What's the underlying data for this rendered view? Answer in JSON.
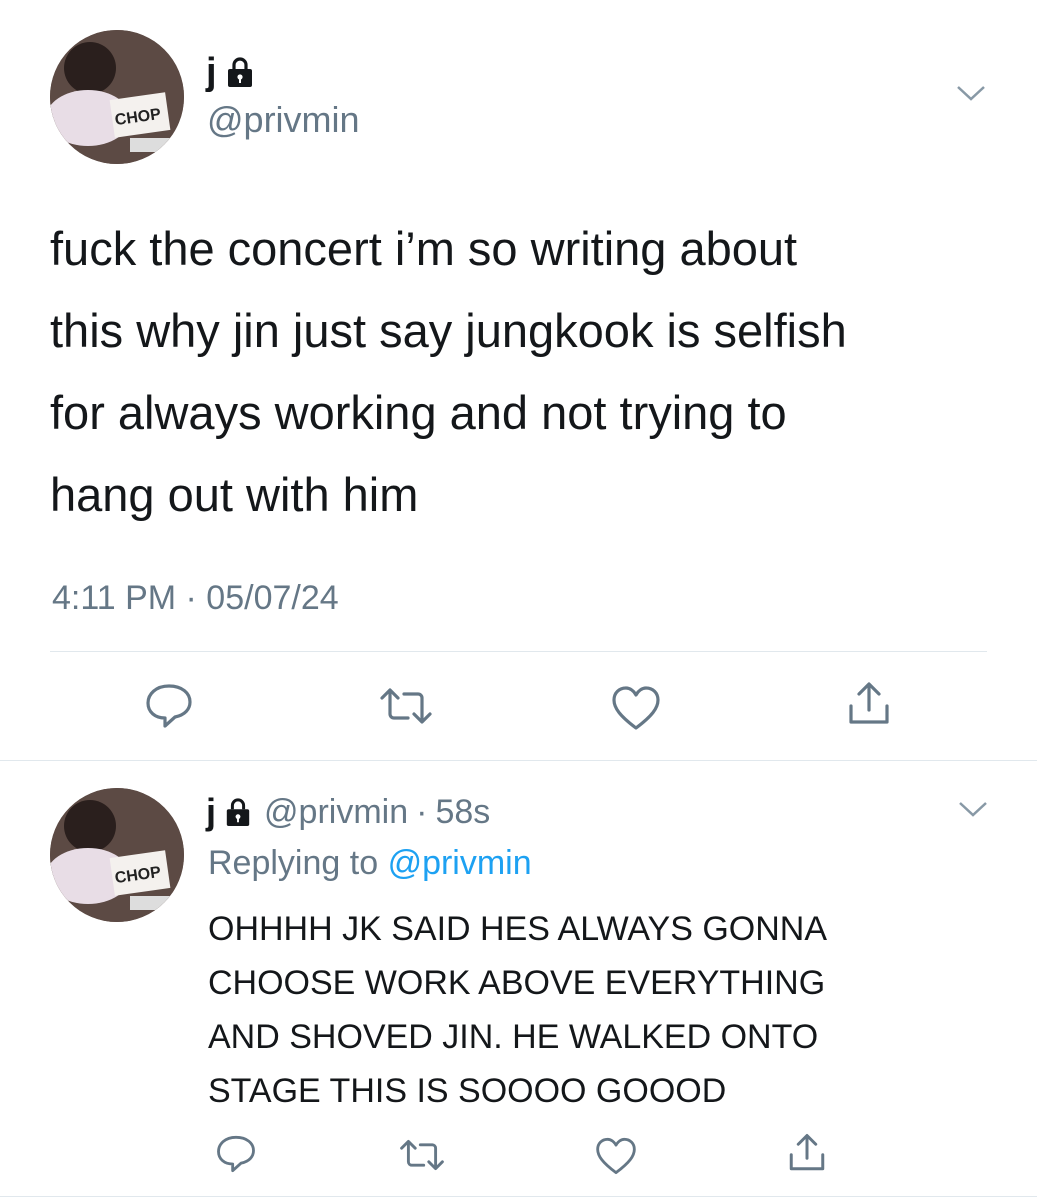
{
  "colors": {
    "text": "#14171a",
    "muted": "#657786",
    "accent": "#1da1f2",
    "divider": "#e1e8ed",
    "background": "#ffffff"
  },
  "main_tweet": {
    "display_name": "j",
    "handle": "@privmin",
    "avatar_sign_text": "CHOP",
    "text_lines": [
      "fuck the concert i’m so writing about",
      "this why jin just say jungkook is selfish",
      "for always working and not trying to",
      "hang out with him"
    ],
    "timestamp": "4:11 PM · 05/07/24",
    "icons": {
      "protected": "lock-icon",
      "menu": "chevron-down-icon",
      "reply": "reply-icon",
      "retweet": "retweet-icon",
      "like": "heart-icon",
      "share": "share-icon"
    }
  },
  "reply_tweet": {
    "display_name": "j",
    "handle": "@privmin",
    "separator": "·",
    "age": "58s",
    "replying_prefix": "Replying to",
    "replying_to": "@privmin",
    "avatar_sign_text": "CHOP",
    "text_lines": [
      "OHHHH JK SAID HES ALWAYS GONNA",
      "CHOOSE WORK ABOVE EVERYTHING",
      "AND SHOVED JIN. HE WALKED ONTO",
      "STAGE THIS IS SOOOO GOOOD"
    ]
  }
}
